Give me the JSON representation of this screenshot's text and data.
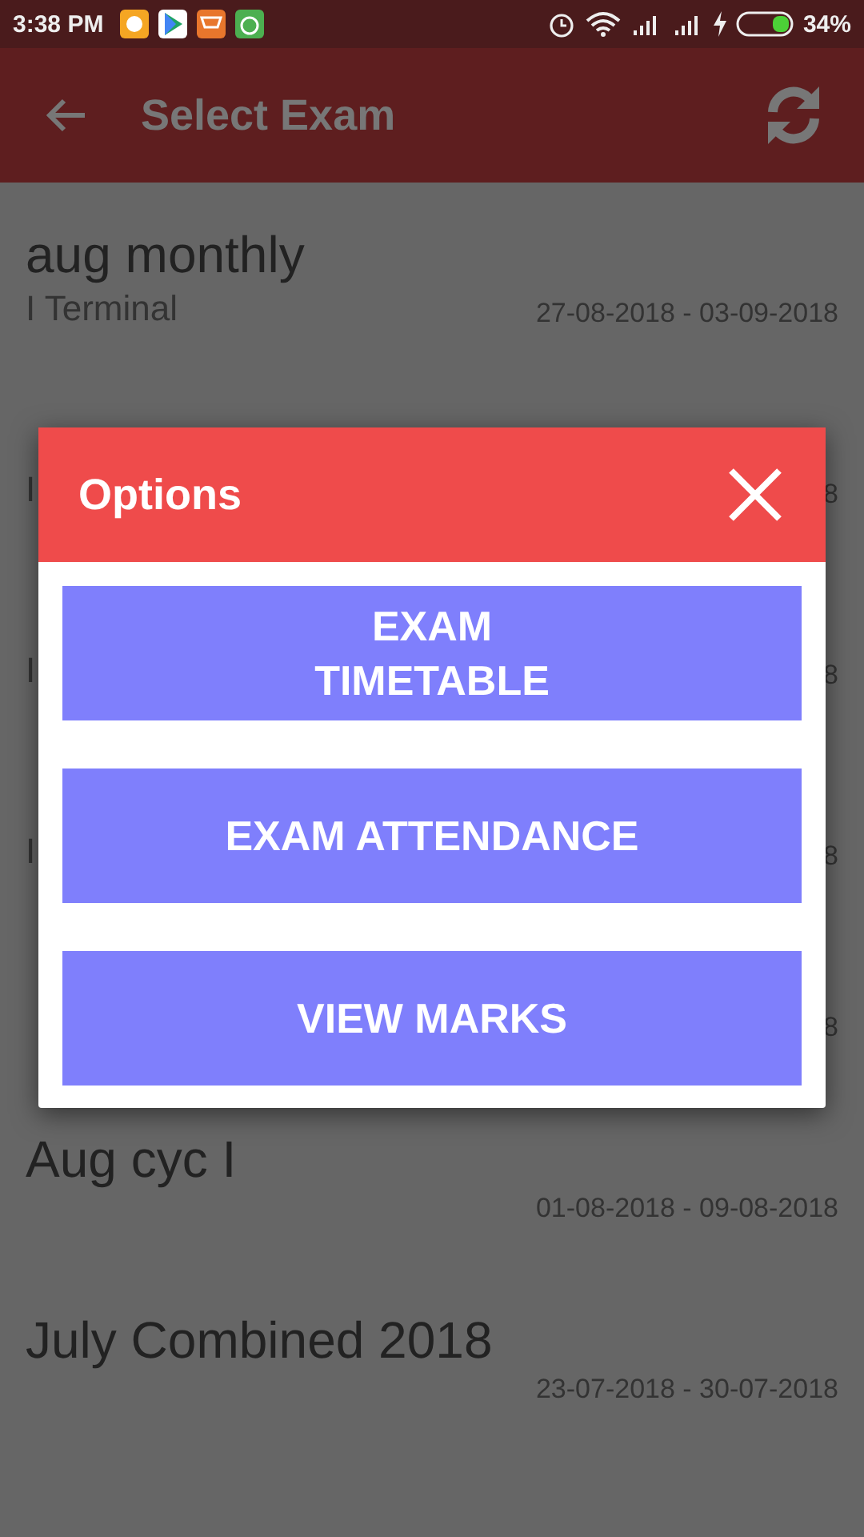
{
  "status_bar": {
    "time": "3:38 PM",
    "battery": "34%"
  },
  "app_bar": {
    "title": "Select Exam"
  },
  "exams": [
    {
      "title": "aug monthly",
      "term": "I Terminal",
      "dates": "27-08-2018 - 03-09-2018"
    },
    {
      "term": "I",
      "dates": "8"
    },
    {
      "term": "I",
      "dates": "8"
    },
    {
      "term": "I",
      "dates": "8"
    },
    {
      "dates": "8"
    },
    {
      "title": "Aug cyc I",
      "dates": "01-08-2018 - 09-08-2018"
    },
    {
      "title": "July Combined 2018",
      "dates": "23-07-2018 - 30-07-2018"
    }
  ],
  "dialog": {
    "title": "Options",
    "buttons": [
      "EXAM\nTIMETABLE",
      "EXAM ATTENDANCE",
      "VIEW MARKS"
    ]
  }
}
